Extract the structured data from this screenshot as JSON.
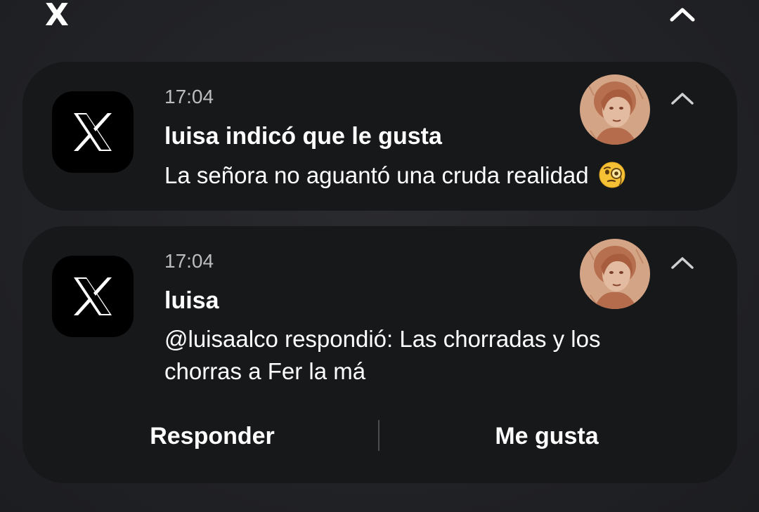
{
  "group": {
    "app_name": "X",
    "collapse_icon": "chevron-up-icon"
  },
  "notifications": [
    {
      "app_icon": "x-logo-icon",
      "time": "17:04",
      "title": "luisa indicó que le gusta",
      "body": "La señora no aguantó una cruda realidad",
      "emoji": "face-with-monocle-emoji",
      "avatar": "avatar-sepia-portrait",
      "expand_icon": "chevron-up-icon"
    },
    {
      "app_icon": "x-logo-icon",
      "time": "17:04",
      "title": "luisa",
      "body": "@luisaalco respondió: Las chorradas y los chorras a Fer la má",
      "avatar": "avatar-sepia-portrait",
      "expand_icon": "chevron-up-icon",
      "actions": [
        "Responder",
        "Me gusta"
      ]
    }
  ],
  "colors": {
    "background": "#232428",
    "card": "#17181a",
    "time_text": "#bdbdbd",
    "avatar_tint": "#c98f72"
  }
}
